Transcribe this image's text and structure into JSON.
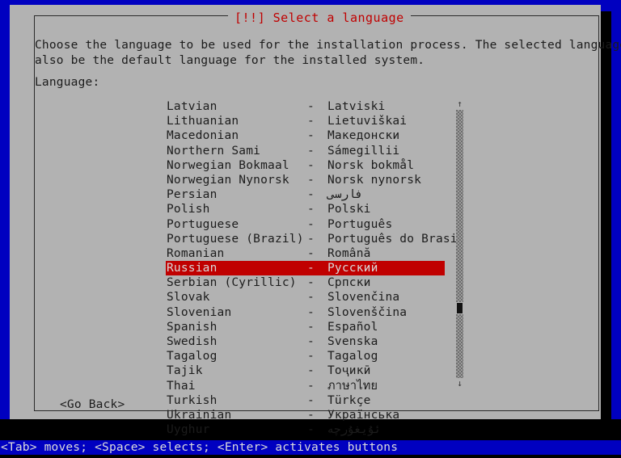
{
  "window": {
    "title": "[!!] Select a language",
    "title_color": "#c00000",
    "background_color": "#0000c0",
    "panel_color": "#b2b2b2"
  },
  "description": {
    "line1": "Choose the language to be used for the installation process. The selected language will",
    "line2": "also be the default language for the installed system."
  },
  "form": {
    "language_label": "Language:"
  },
  "language_list": {
    "separator": "-",
    "selected_index": 11,
    "items": [
      {
        "english": "Latvian",
        "native": "Latviski",
        "rtl": false
      },
      {
        "english": "Lithuanian",
        "native": "Lietuviškai",
        "rtl": false
      },
      {
        "english": "Macedonian",
        "native": "Македонски",
        "rtl": false
      },
      {
        "english": "Northern Sami",
        "native": "Sámegillii",
        "rtl": false
      },
      {
        "english": "Norwegian Bokmaal",
        "native": "Norsk bokmål",
        "rtl": false
      },
      {
        "english": "Norwegian Nynorsk",
        "native": "Norsk nynorsk",
        "rtl": false
      },
      {
        "english": "Persian",
        "native": "فارسی",
        "rtl": true
      },
      {
        "english": "Polish",
        "native": "Polski",
        "rtl": false
      },
      {
        "english": "Portuguese",
        "native": "Português",
        "rtl": false
      },
      {
        "english": "Portuguese (Brazil)",
        "native": "Português do Brasil",
        "rtl": false
      },
      {
        "english": "Romanian",
        "native": "Română",
        "rtl": false
      },
      {
        "english": "Russian",
        "native": "Русский",
        "rtl": false
      },
      {
        "english": "Serbian (Cyrillic)",
        "native": "Српски",
        "rtl": false
      },
      {
        "english": "Slovak",
        "native": "Slovenčina",
        "rtl": false
      },
      {
        "english": "Slovenian",
        "native": "Slovenščina",
        "rtl": false
      },
      {
        "english": "Spanish",
        "native": "Español",
        "rtl": false
      },
      {
        "english": "Swedish",
        "native": "Svenska",
        "rtl": false
      },
      {
        "english": "Tagalog",
        "native": "Tagalog",
        "rtl": false
      },
      {
        "english": "Tajik",
        "native": "Тоҷикӣ",
        "rtl": false
      },
      {
        "english": "Thai",
        "native": "ภาษาไทย",
        "rtl": false
      },
      {
        "english": "Turkish",
        "native": "Türkçe",
        "rtl": false
      },
      {
        "english": "Ukrainian",
        "native": "Українська",
        "rtl": false
      },
      {
        "english": "Uyghur",
        "native": "ئۇيغۇرچە",
        "rtl": true
      }
    ],
    "selected_highlight_color": "#c00000"
  },
  "scrollbar": {
    "up_arrow": "↑",
    "down_arrow": "↓"
  },
  "buttons": {
    "go_back": "<Go Back>"
  },
  "status_bar": {
    "text": "<Tab> moves; <Space> selects; <Enter> activates buttons"
  }
}
